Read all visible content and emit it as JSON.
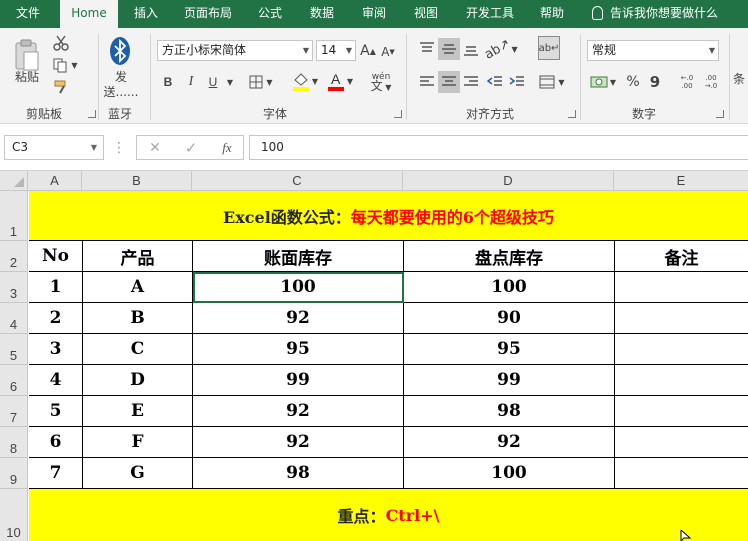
{
  "tabs": [
    "文件",
    "Home",
    "插入",
    "页面布局",
    "公式",
    "数据",
    "审阅",
    "视图",
    "开发工具",
    "帮助"
  ],
  "tell_me": "告诉我你想要做什么",
  "ribbon": {
    "clipboard": {
      "paste": "粘贴",
      "label": "剪贴板"
    },
    "bluetooth": {
      "send": "发送......",
      "label": "蓝牙"
    },
    "font": {
      "name": "方正小标宋简体",
      "size": "14",
      "label": "字体",
      "bold": "B",
      "italic": "I",
      "underline": "U",
      "grow": "A",
      "shrink": "A",
      "phonetic": "wén"
    },
    "alignment": {
      "label": "对齐方式"
    },
    "number": {
      "format": "常规",
      "label": "数字",
      "percent": "%",
      "comma": "9",
      "inc_dec": "←.0 .00",
      "dec_dec": ".00 →.0"
    },
    "styles": {
      "partial": "条"
    }
  },
  "formula_bar": {
    "name_box": "C3",
    "value": "100",
    "fx": "fx"
  },
  "columns": [
    "A",
    "B",
    "C",
    "D",
    "E"
  ],
  "rows": [
    "1",
    "2",
    "3",
    "4",
    "5",
    "6",
    "7",
    "8",
    "9",
    "10"
  ],
  "sheet": {
    "title_black": "Excel函数公式：",
    "title_red": "每天都要使用的6个超级技巧",
    "headers": [
      "No",
      "产品",
      "账面库存",
      "盘点库存",
      "备注"
    ],
    "data": [
      [
        "1",
        "A",
        "100",
        "100",
        ""
      ],
      [
        "2",
        "B",
        "92",
        "90",
        ""
      ],
      [
        "3",
        "C",
        "95",
        "95",
        ""
      ],
      [
        "4",
        "D",
        "99",
        "99",
        ""
      ],
      [
        "5",
        "E",
        "92",
        "98",
        ""
      ],
      [
        "6",
        "F",
        "92",
        "92",
        ""
      ],
      [
        "7",
        "G",
        "98",
        "100",
        ""
      ]
    ],
    "footer_black": "重点：",
    "footer_red": "Ctrl+\\"
  },
  "colors": {
    "excel_green": "#217346",
    "highlight_yellow": "#ffff00",
    "title_red": "#ff0000",
    "bluetooth_blue": "#1f5fa8"
  }
}
